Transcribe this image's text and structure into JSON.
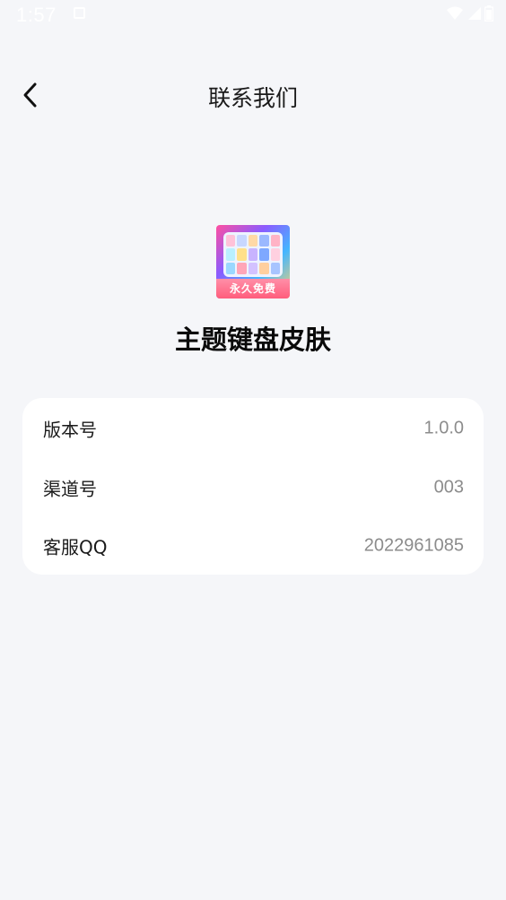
{
  "status_bar": {
    "time": "1:57",
    "icons": [
      "notification-icon",
      "wifi-icon",
      "signal-icon",
      "battery-icon"
    ]
  },
  "header": {
    "title": "联系我们",
    "back_icon": "chevron-left-icon"
  },
  "app": {
    "name": "主题键盘皮肤",
    "icon_banner": "永久免费"
  },
  "info": {
    "rows": [
      {
        "label": "版本号",
        "value": "1.0.0"
      },
      {
        "label": "渠道号",
        "value": "003"
      },
      {
        "label": "客服QQ",
        "value": "2022961085"
      }
    ]
  },
  "colors": {
    "background": "#f5f6f9",
    "card": "#ffffff",
    "value_text": "#8c8c8c",
    "title_text": "#1a1a1a"
  }
}
